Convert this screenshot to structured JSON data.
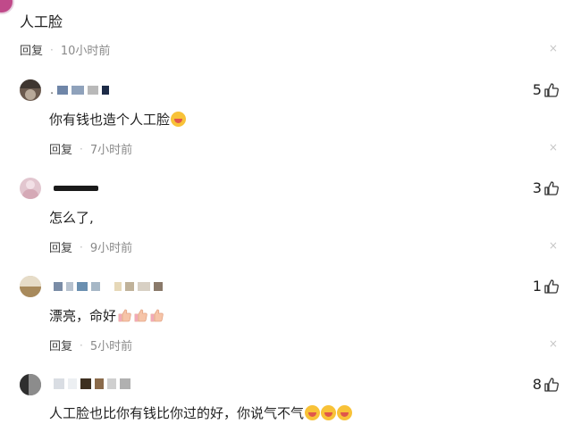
{
  "parent": {
    "text": "人工脸",
    "reply_label": "回复",
    "dot": "·",
    "time": "10小时前",
    "close": "×"
  },
  "replies": [
    {
      "username": ".",
      "text": "你有钱也造个人工脸",
      "emojis": [
        "laugh-tears-emoji"
      ],
      "likes": "5",
      "reply_label": "回复",
      "time": "7小时前",
      "close": "×",
      "avatar_color": "#6b5a4e"
    },
    {
      "username": "",
      "text": "怎么了,",
      "emojis": [],
      "likes": "3",
      "reply_label": "回复",
      "time": "9小时前",
      "close": "×",
      "avatar_color": "#e2c6cf"
    },
    {
      "username": "",
      "text": "漂亮，命好",
      "emojis": [
        "thumbs-up-emoji",
        "thumbs-up-emoji",
        "thumbs-up-emoji"
      ],
      "likes": "1",
      "reply_label": "回复",
      "time": "5小时前",
      "close": "×",
      "avatar_color": "#c9b08a"
    },
    {
      "username": "",
      "text": "人工脸也比你有钱比你过的好，你说气不气",
      "emojis": [
        "grin-emoji",
        "grin-emoji",
        "grin-emoji"
      ],
      "likes": "8",
      "avatar_color": "#5a5a5a"
    }
  ],
  "colors": {
    "text": "#222222",
    "meta": "#8a8a8a",
    "close": "#c6c6c6",
    "parent_avatar": "#c04a8a"
  },
  "icons": {
    "like": "thumb-up-outline-icon",
    "close": "close-icon"
  }
}
